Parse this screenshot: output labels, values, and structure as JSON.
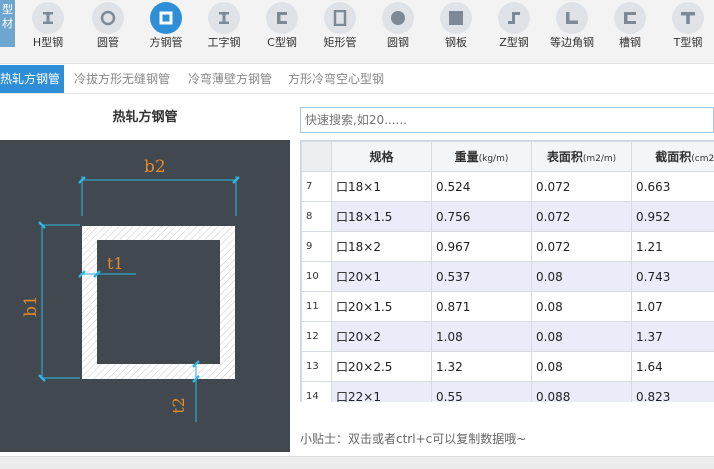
{
  "logo": {
    "text": "型材"
  },
  "toolbar": {
    "items": [
      {
        "label": "H型钢",
        "icon": "i-beam-icon"
      },
      {
        "label": "圆管",
        "icon": "ring-icon"
      },
      {
        "label": "方钢管",
        "icon": "square-tube-icon"
      },
      {
        "label": "工字钢",
        "icon": "i-beam-icon"
      },
      {
        "label": "C型钢",
        "icon": "c-channel-icon"
      },
      {
        "label": "矩形管",
        "icon": "rect-tube-icon"
      },
      {
        "label": "圆钢",
        "icon": "round-bar-icon"
      },
      {
        "label": "钢板",
        "icon": "plate-icon"
      },
      {
        "label": "Z型钢",
        "icon": "z-section-icon"
      },
      {
        "label": "等边角钢",
        "icon": "angle-icon"
      },
      {
        "label": "槽钢",
        "icon": "channel-icon"
      },
      {
        "label": "T型钢",
        "icon": "t-section-icon"
      }
    ],
    "active_index": 2
  },
  "subtabs": [
    {
      "label": "热轧方钢管",
      "active": true
    },
    {
      "label": "冷拔方形无缝钢管",
      "active": false
    },
    {
      "label": "冷弯薄壁方钢管",
      "active": false
    },
    {
      "label": "方形冷弯空心型钢",
      "active": false
    }
  ],
  "left": {
    "title": "热轧方钢管",
    "diagram_labels": {
      "b2": "b2",
      "b1": "b1",
      "t1": "t1",
      "t2": "t2"
    }
  },
  "search": {
    "placeholder": "快速搜索,如20......"
  },
  "table": {
    "headers": {
      "spec": "规格",
      "weight": "重量",
      "weight_unit": "(kg/m)",
      "area": "表面积",
      "area_unit": "(m2/m)",
      "section": "截面积",
      "section_unit": "(cm2)"
    },
    "rows": [
      {
        "idx": "7",
        "spec": "口18×1",
        "weight": "0.524",
        "surface": "0.072",
        "section": "0.663"
      },
      {
        "idx": "8",
        "spec": "口18×1.5",
        "weight": "0.756",
        "surface": "0.072",
        "section": "0.952"
      },
      {
        "idx": "9",
        "spec": "口18×2",
        "weight": "0.967",
        "surface": "0.072",
        "section": "1.21"
      },
      {
        "idx": "10",
        "spec": "口20×1",
        "weight": "0.537",
        "surface": "0.08",
        "section": "0.743"
      },
      {
        "idx": "11",
        "spec": "口20×1.5",
        "weight": "0.871",
        "surface": "0.08",
        "section": "1.07"
      },
      {
        "idx": "12",
        "spec": "口20×2",
        "weight": "1.08",
        "surface": "0.08",
        "section": "1.37"
      },
      {
        "idx": "13",
        "spec": "口20×2.5",
        "weight": "1.32",
        "surface": "0.08",
        "section": "1.64"
      },
      {
        "idx": "14",
        "spec": "口22×1",
        "weight": "0.55",
        "surface": "0.088",
        "section": "0.823"
      }
    ]
  },
  "tip": "小贴士：双击或者ctrl+c可以复制数据哦~",
  "colors": {
    "accent": "#2f8ed8",
    "diagram_bg": "#42484f",
    "dim_line": "#2fb6e0",
    "label": "#e08a28"
  }
}
